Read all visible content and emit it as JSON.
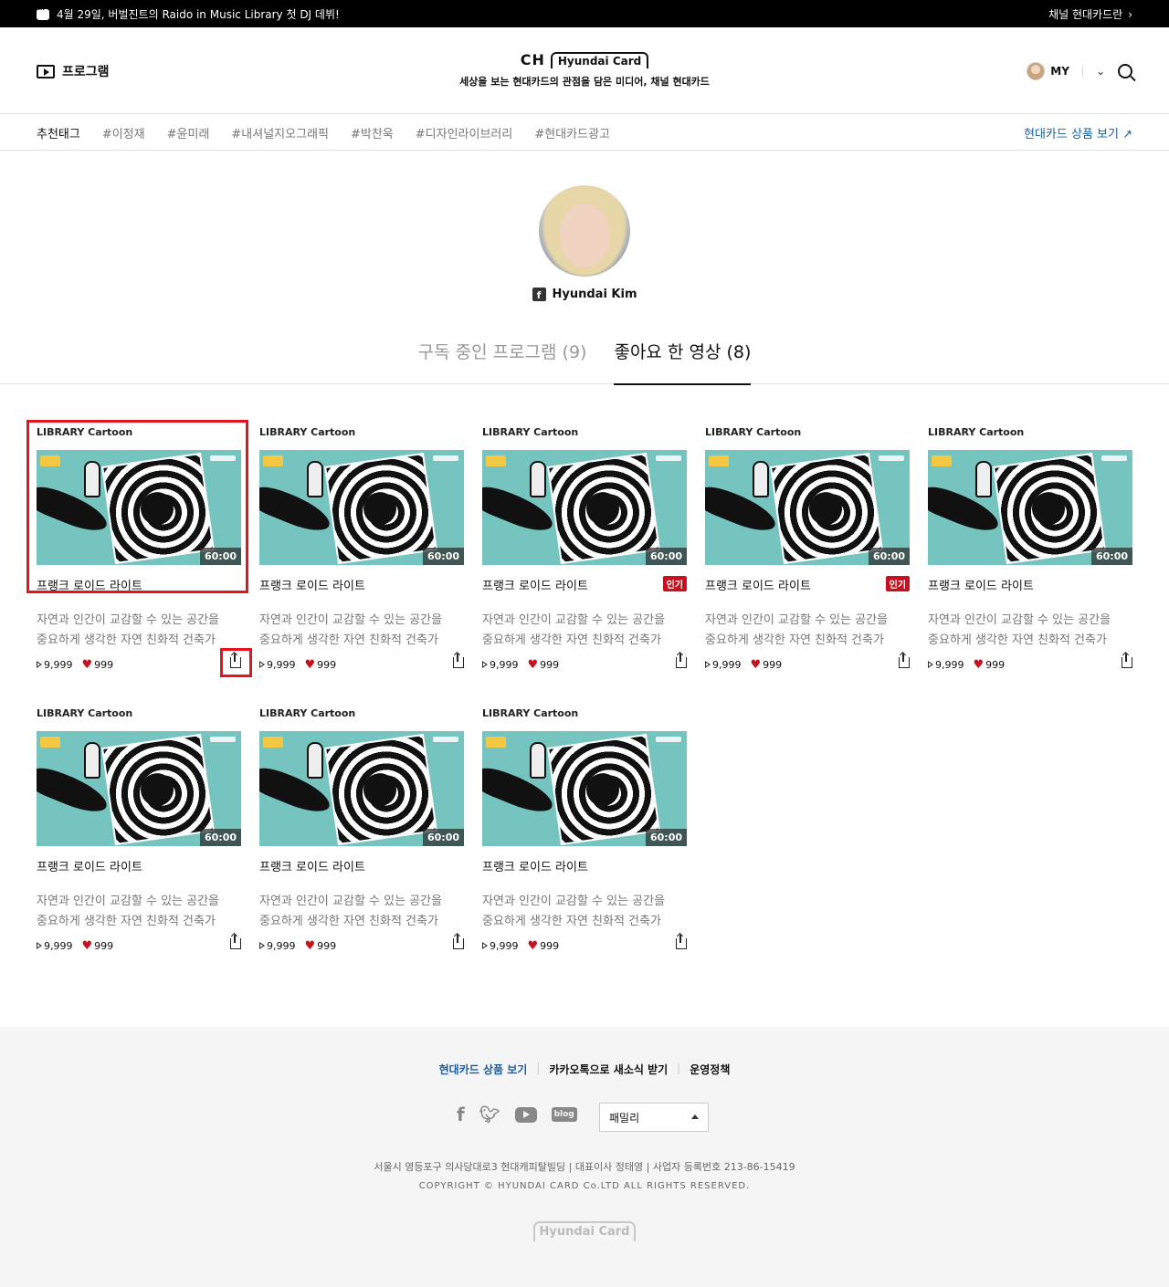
{
  "notice": {
    "message": "4월 29일, 버벌진트의 Raido in Music Library 첫 DJ 데뷔!",
    "right_link": "채널 현대카드란"
  },
  "header": {
    "program_label": "프로그램",
    "logo_ch": "CH",
    "logo_brand": "Hyundai Card",
    "tagline": "세상을 보는 현대카드의 관점을 담은 미디어, 채널 현대카드",
    "my_label": "MY"
  },
  "tagnav": {
    "tags": [
      "추천태그",
      "#이정재",
      "#윤미래",
      "#내셔널지오그래픽",
      "#박찬욱",
      "#디자인라이브러리",
      "#현대카드광고"
    ],
    "shop_link": "현대카드 상품 보기 ↗"
  },
  "profile": {
    "name": "Hyundai Kim",
    "tabs": [
      {
        "label": "구독 중인 프로그램 (9)",
        "active": false
      },
      {
        "label": "좋아요 한 영상 (8)",
        "active": true
      }
    ]
  },
  "videos": [
    {
      "category": "LIBRARY Cartoon",
      "duration": "60:00",
      "title": "프랭크 로이드 라이트",
      "badge": "",
      "desc1": "자연과 인간이 교감할 수 있는 공간을",
      "desc2": "중요하게 생각한 자연 친화적 건축가",
      "plays": "9,999",
      "likes": "999"
    },
    {
      "category": "LIBRARY Cartoon",
      "duration": "60:00",
      "title": "프랭크 로이드 라이트",
      "badge": "",
      "desc1": "자연과 인간이 교감할 수 있는 공간을",
      "desc2": "중요하게 생각한 자연 친화적 건축가",
      "plays": "9,999",
      "likes": "999"
    },
    {
      "category": "LIBRARY Cartoon",
      "duration": "60:00",
      "title": "프랭크 로이드 라이트",
      "badge": "인기",
      "desc1": "자연과 인간이 교감할 수 있는 공간을",
      "desc2": "중요하게 생각한 자연 친화적 건축가",
      "plays": "9,999",
      "likes": "999"
    },
    {
      "category": "LIBRARY Cartoon",
      "duration": "60:00",
      "title": "프랭크 로이드 라이트",
      "badge": "인기",
      "desc1": "자연과 인간이 교감할 수 있는 공간을",
      "desc2": "중요하게 생각한 자연 친화적 건축가",
      "plays": "9,999",
      "likes": "999"
    },
    {
      "category": "LIBRARY Cartoon",
      "duration": "60:00",
      "title": "프랭크 로이드 라이트",
      "badge": "",
      "desc1": "자연과 인간이 교감할 수 있는 공간을",
      "desc2": "중요하게 생각한 자연 친화적 건축가",
      "plays": "9,999",
      "likes": "999"
    },
    {
      "category": "LIBRARY Cartoon",
      "duration": "60:00",
      "title": "프랭크 로이드 라이트",
      "badge": "",
      "desc1": "자연과 인간이 교감할 수 있는 공간을",
      "desc2": "중요하게 생각한 자연 친화적 건축가",
      "plays": "9,999",
      "likes": "999"
    },
    {
      "category": "LIBRARY Cartoon",
      "duration": "60:00",
      "title": "프랭크 로이드 라이트",
      "badge": "",
      "desc1": "자연과 인간이 교감할 수 있는 공간을",
      "desc2": "중요하게 생각한 자연 친화적 건축가",
      "plays": "9,999",
      "likes": "999"
    },
    {
      "category": "LIBRARY Cartoon",
      "duration": "60:00",
      "title": "프랭크 로이드 라이트",
      "badge": "",
      "desc1": "자연과 인간이 교감할 수 있는 공간을",
      "desc2": "중요하게 생각한 자연 친화적 건축가",
      "plays": "9,999",
      "likes": "999"
    }
  ],
  "footer": {
    "links": [
      "현대카드 상품 보기",
      "카카오톡으로 새소식 받기",
      "운영정책"
    ],
    "social": [
      "facebook-icon",
      "twitter-icon",
      "youtube-icon",
      "blog-icon"
    ],
    "blog_label": "blog",
    "family_select": "패밀리",
    "address": "서울시 영등포구 의사당대로3 현대캐피탈빌딩 | 대표이사 정태영 | 사업자 등록번호 213-86-15419",
    "copyright": "COPYRIGHT © HYUNDAI CARD Co.LTD ALL RIGHTS RESERVED.",
    "logo": "Hyundai Card"
  },
  "colors": {
    "accent_blue": "#1a5fa5",
    "badge_red": "#c8101e",
    "highlight_red": "#e3141c",
    "thumb_teal": "#76c4c0"
  }
}
